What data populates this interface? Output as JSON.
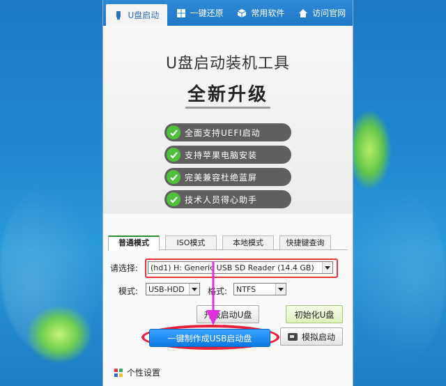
{
  "nav": {
    "tabs": [
      {
        "label": "U盘启动",
        "icon": "usb-icon"
      },
      {
        "label": "一键还原",
        "icon": "windows-icon"
      },
      {
        "label": "常用软件",
        "icon": "box-icon"
      },
      {
        "label": "访问官网",
        "icon": "home-icon"
      }
    ],
    "active_index": 0
  },
  "hero": {
    "title": "U盘启动装机工具",
    "subtitle": "全新升级",
    "features": [
      "全面支持UEFI启动",
      "支持苹果电脑安装",
      "完美兼容杜绝蓝屏",
      "技术人员得心助手"
    ]
  },
  "modes": {
    "tabs": [
      "普通模式",
      "ISO模式",
      "本地模式",
      "快捷键查询"
    ],
    "active_index": 0
  },
  "form": {
    "select_label": "请选择:",
    "device_value": "(hd1) H: Generic USB  SD Reader (14.4 GB)",
    "mode_label": "模式:",
    "mode_value": "USB-HDD",
    "format_label": "格式:",
    "format_value": "NTFS"
  },
  "buttons": {
    "upgrade": "升级启动U盘",
    "init": "初始化U盘",
    "make": "一键制作成USB启动盘",
    "simulate": "模拟启动"
  },
  "footer": {
    "settings": "个性设置"
  },
  "colors": {
    "accent_blue": "#1f77c6",
    "highlight_red": "#e3343a",
    "arrow_magenta": "#e02fe0",
    "check_green": "#4fc13b"
  }
}
